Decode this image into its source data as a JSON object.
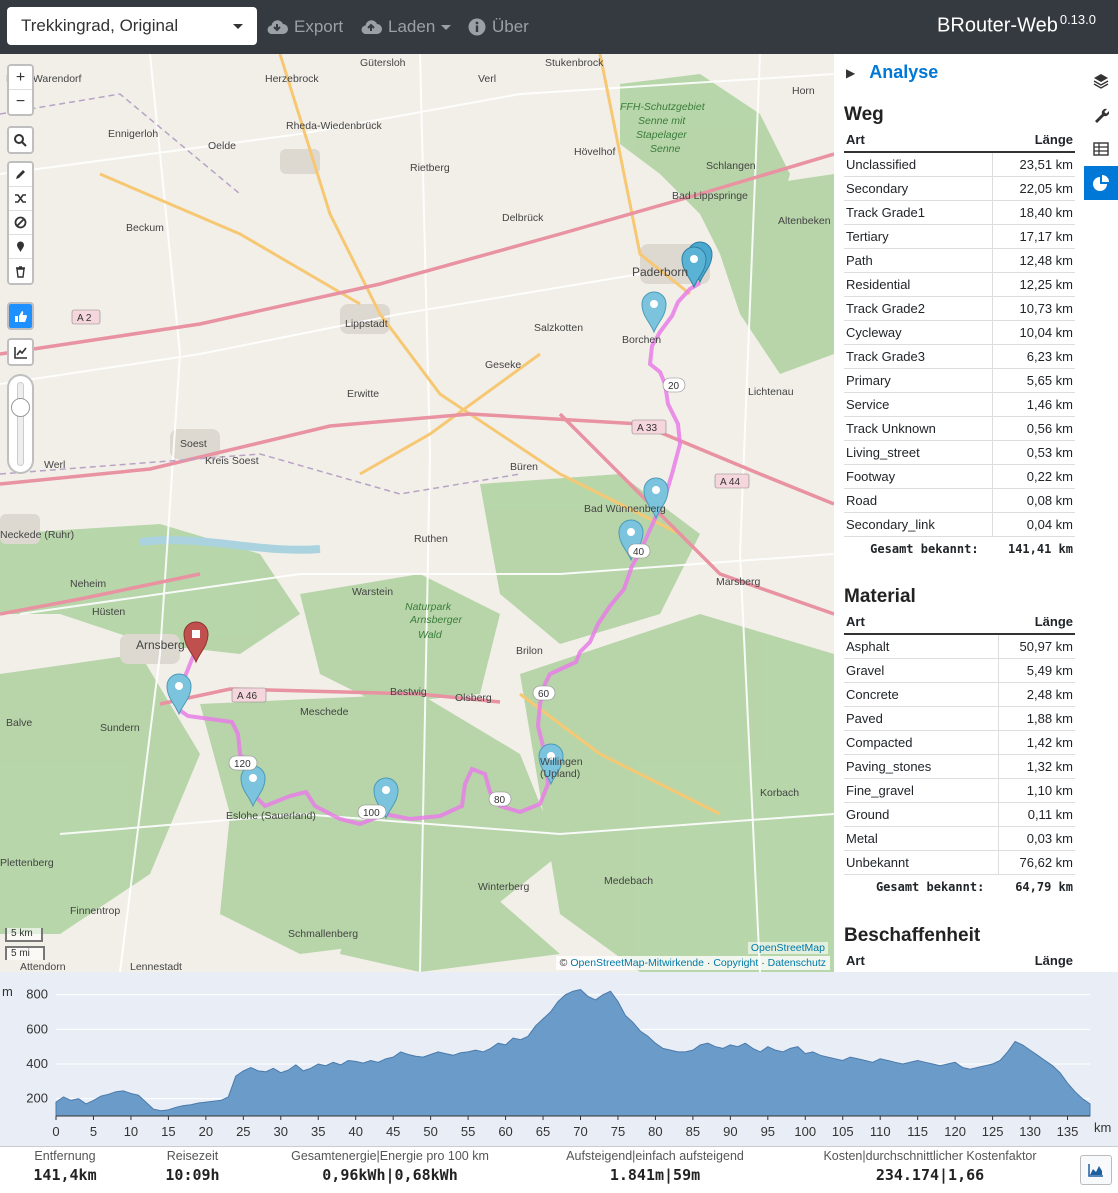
{
  "topbar": {
    "profile": "Trekkingrad, Original",
    "export_label": "Export",
    "load_label": "Laden",
    "about_label": "Über",
    "brand": "BRouter-Web",
    "version": "0.13.0"
  },
  "map": {
    "places": [
      "Gütersloh",
      "Stukenbrock",
      "Herzebrock",
      "Verl",
      "Horn",
      "Kreis Warendorf",
      "Rheda-Wiedenbrück",
      "FFH-Schutzgebiet",
      "Senne mit",
      "Stapelager",
      "Senne",
      "Oelde",
      "Ennigerloh",
      "Rietberg",
      "Hövelhof",
      "Schlangen",
      "Bad Lippspringe",
      "Beckum",
      "Delbrück",
      "Altenbeken",
      "Paderborn",
      "Lippstadt",
      "Salzkotten",
      "Borchen",
      "Geseke",
      "Erwitte",
      "Lichtenau",
      "Soest",
      "Werl",
      "Kreis Soest",
      "Büren",
      "Bad Wünnenberg",
      "Ruthen",
      "Marsberg",
      "Neheim",
      "Hüsten",
      "Warstein",
      "Naturpark",
      "Arnsberger",
      "Wald",
      "Brilon",
      "Arnsberg",
      "Bestwig",
      "Olsberg",
      "Meschede",
      "Sundern",
      "Balve",
      "Willingen",
      "(Upland)",
      "Eslohe (Sauerland)",
      "Korbach",
      "Medebach",
      "Winterberg",
      "Plettenberg",
      "Finnentrop",
      "Schmallenberg",
      "Lennestadt",
      "Attendorn",
      "Neckede (Ruhr)"
    ],
    "road_labels": [
      "A 2",
      "A 33",
      "A 44",
      "A 46",
      "20",
      "40",
      "60",
      "80",
      "100",
      "120"
    ],
    "scale_km": "5 km",
    "scale_mi": "5 mi",
    "osm_tag": "OpenStreetMap",
    "attribution_prefix": "©",
    "attribution_osm": "OpenStreetMap-Mitwirkende",
    "attribution_copyright": "Copyright",
    "attribution_privacy": "Datenschutz",
    "route_color": "#e87ee8",
    "marker_color": "#5ab3d4",
    "end_marker_color": "#c0504d"
  },
  "sidebar": {
    "panel_title": "Analyse",
    "weg": {
      "title": "Weg",
      "col_type": "Art",
      "col_length": "Länge",
      "rows": [
        [
          "Unclassified",
          "23,51 km"
        ],
        [
          "Secondary",
          "22,05 km"
        ],
        [
          "Track Grade1",
          "18,40 km"
        ],
        [
          "Tertiary",
          "17,17 km"
        ],
        [
          "Path",
          "12,48 km"
        ],
        [
          "Residential",
          "12,25 km"
        ],
        [
          "Track Grade2",
          "10,73 km"
        ],
        [
          "Cycleway",
          "10,04 km"
        ],
        [
          "Track Grade3",
          "6,23 km"
        ],
        [
          "Primary",
          "5,65 km"
        ],
        [
          "Service",
          "1,46 km"
        ],
        [
          "Track Unknown",
          "0,56 km"
        ],
        [
          "Living_street",
          "0,53 km"
        ],
        [
          "Footway",
          "0,22 km"
        ],
        [
          "Road",
          "0,08 km"
        ],
        [
          "Secondary_link",
          "0,04 km"
        ]
      ],
      "total_label": "Gesamt bekannt:",
      "total_value": "141,41 km"
    },
    "material": {
      "title": "Material",
      "col_type": "Art",
      "col_length": "Länge",
      "rows": [
        [
          "Asphalt",
          "50,97 km"
        ],
        [
          "Gravel",
          "5,49 km"
        ],
        [
          "Concrete",
          "2,48 km"
        ],
        [
          "Paved",
          "1,88 km"
        ],
        [
          "Compacted",
          "1,42 km"
        ],
        [
          "Paving_stones",
          "1,32 km"
        ],
        [
          "Fine_gravel",
          "1,10 km"
        ],
        [
          "Ground",
          "0,11 km"
        ],
        [
          "Metal",
          "0,03 km"
        ],
        [
          "Unbekannt",
          "76,62 km"
        ]
      ],
      "total_label": "Gesamt bekannt:",
      "total_value": "64,79 km"
    },
    "beschaffenheit": {
      "title": "Beschaffenheit",
      "col_type": "Art",
      "col_length": "Länge"
    }
  },
  "chart_data": {
    "type": "area",
    "ylabel": "m",
    "xlabel": "km",
    "xlim": [
      0,
      138
    ],
    "ylim": [
      100,
      850
    ],
    "xticks": [
      0,
      5,
      10,
      15,
      20,
      25,
      30,
      35,
      40,
      45,
      50,
      55,
      60,
      65,
      70,
      75,
      80,
      85,
      90,
      95,
      100,
      105,
      110,
      115,
      120,
      125,
      130,
      135
    ],
    "yticks": [
      200,
      400,
      600,
      800
    ],
    "x": [
      0,
      1,
      2,
      3,
      4,
      5,
      6,
      7,
      8,
      9,
      10,
      11,
      12,
      13,
      14,
      15,
      16,
      17,
      18,
      19,
      20,
      21,
      22,
      23,
      24,
      25,
      26,
      27,
      28,
      29,
      30,
      31,
      32,
      33,
      34,
      35,
      36,
      37,
      38,
      39,
      40,
      41,
      42,
      43,
      44,
      45,
      46,
      47,
      48,
      49,
      50,
      51,
      52,
      53,
      54,
      55,
      56,
      57,
      58,
      59,
      60,
      61,
      62,
      63,
      64,
      65,
      66,
      67,
      68,
      69,
      70,
      71,
      72,
      73,
      74,
      75,
      76,
      77,
      78,
      79,
      80,
      81,
      82,
      83,
      84,
      85,
      86,
      87,
      88,
      89,
      90,
      91,
      92,
      93,
      94,
      95,
      96,
      97,
      98,
      99,
      100,
      101,
      102,
      103,
      104,
      105,
      106,
      107,
      108,
      109,
      110,
      111,
      112,
      113,
      114,
      115,
      116,
      117,
      118,
      119,
      120,
      121,
      122,
      123,
      124,
      125,
      126,
      127,
      128,
      129,
      130,
      131,
      132,
      133,
      134,
      135,
      136,
      137,
      138
    ],
    "values": [
      180,
      210,
      190,
      200,
      170,
      190,
      215,
      225,
      240,
      245,
      230,
      220,
      180,
      140,
      130,
      135,
      150,
      160,
      165,
      175,
      180,
      185,
      190,
      210,
      330,
      360,
      380,
      360,
      355,
      375,
      350,
      365,
      395,
      360,
      375,
      400,
      390,
      410,
      395,
      420,
      415,
      405,
      420,
      410,
      430,
      440,
      470,
      455,
      445,
      440,
      455,
      470,
      460,
      450,
      465,
      470,
      480,
      470,
      490,
      520,
      510,
      550,
      540,
      560,
      620,
      660,
      700,
      760,
      800,
      820,
      830,
      790,
      770,
      800,
      820,
      760,
      680,
      640,
      590,
      560,
      520,
      490,
      480,
      470,
      470,
      480,
      510,
      520,
      500,
      490,
      510,
      500,
      520,
      490,
      470,
      500,
      480,
      470,
      490,
      500,
      460,
      470,
      450,
      440,
      430,
      420,
      440,
      430,
      420,
      410,
      430,
      420,
      410,
      400,
      410,
      420,
      410,
      400,
      390,
      400,
      410,
      380,
      370,
      380,
      390,
      400,
      420,
      470,
      530,
      510,
      480,
      450,
      420,
      390,
      350,
      290,
      240,
      200,
      170
    ]
  },
  "stats": [
    {
      "label": "Entfernung",
      "value": "141,4km"
    },
    {
      "label": "Reisezeit",
      "value": "10:09h"
    },
    {
      "label": "Gesamtenergie|Energie pro 100 km",
      "value": "0,96kWh|0,68kWh"
    },
    {
      "label": "Aufsteigend|einfach aufsteigend",
      "value": "1.841m|59m"
    },
    {
      "label": "Kosten|durchschnittlicher Kostenfaktor",
      "value": "234.174|1,66"
    }
  ]
}
